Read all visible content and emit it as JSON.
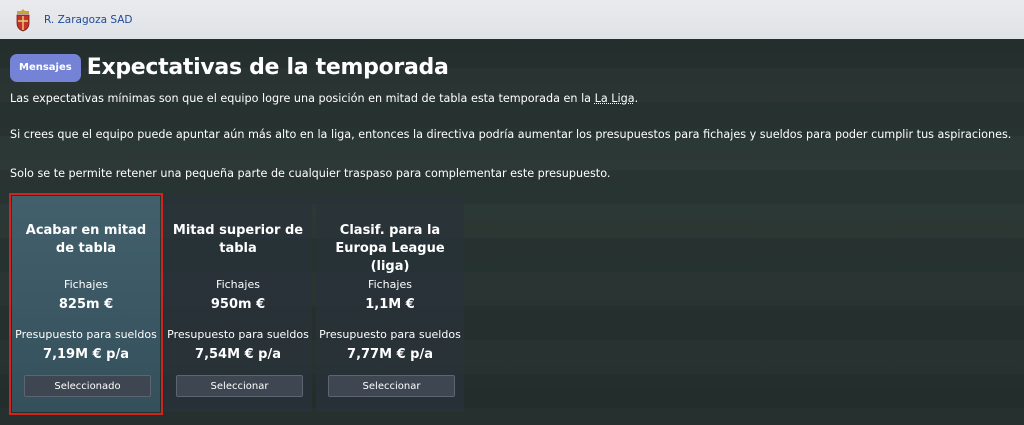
{
  "topbar": {
    "club_name": "R. Zaragoza SAD",
    "crest_icon": "club-crest-icon"
  },
  "header": {
    "messages_label": "Mensajes",
    "title": "Expectativas de la temporada"
  },
  "paragraphs": {
    "p1_before": "Las expectativas mínimas son que el equipo logre una posición en mitad de tabla esta temporada en la ",
    "p1_link": "La Liga",
    "p1_after": ".",
    "p2": "Si crees que el equipo puede apuntar aún más alto en la liga, entonces la directiva podría aumentar los presupuestos para fichajes y sueldos para poder cumplir tus aspiraciones.",
    "p3": "Solo se te permite retener una pequeña parte de cualquier traspaso para complementar este presupuesto."
  },
  "options": [
    {
      "title": "Acabar en mitad de tabla",
      "transfers_label": "Fichajes",
      "transfers_value": "825m €",
      "wages_label": "Presupuesto para sueldos",
      "wages_value": "7,19M € p/a",
      "button": "Seleccionado"
    },
    {
      "title": "Mitad superior de tabla",
      "transfers_label": "Fichajes",
      "transfers_value": "950m €",
      "wages_label": "Presupuesto para sueldos",
      "wages_value": "7,54M € p/a",
      "button": "Seleccionar"
    },
    {
      "title": "Clasif. para la Europa League (liga)",
      "transfers_label": "Fichajes",
      "transfers_value": "1,1M €",
      "wages_label": "Presupuesto para sueldos",
      "wages_value": "7,77M € p/a",
      "button": "Seleccionar"
    }
  ],
  "colors": {
    "accent": "#7583d6",
    "selected_outline": "#d0241f",
    "club_link": "#1e4a9c"
  }
}
